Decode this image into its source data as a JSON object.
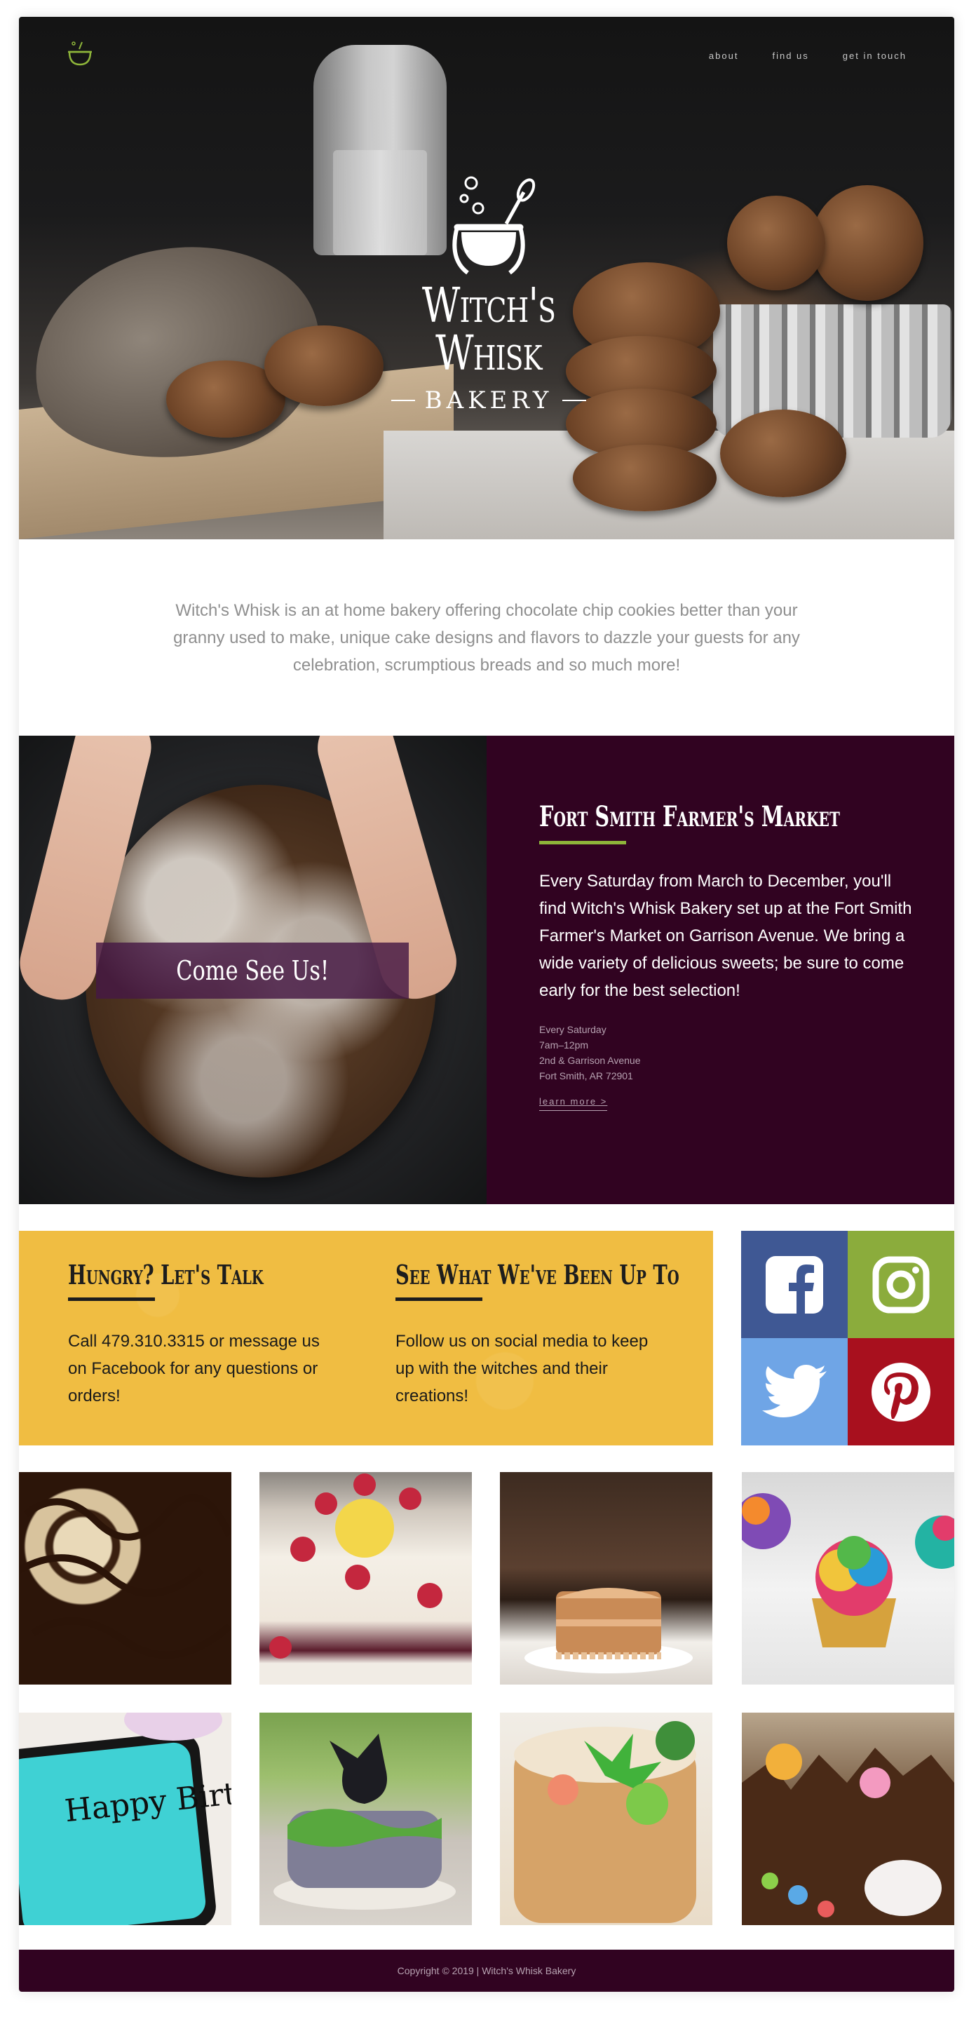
{
  "nav": {
    "items": [
      "about",
      "find us",
      "get in touch"
    ]
  },
  "hero": {
    "brand_name": "Witch's Whisk",
    "brand_sub": "BAKERY"
  },
  "intro": {
    "text": "Witch's Whisk is an at home bakery offering chocolate chip cookies better than your granny used to make, unique cake designs and flavors to dazzle your guests for any celebration, scrumptious breads and so much more!"
  },
  "market": {
    "cta": "Come See Us!",
    "title": "Fort Smith Farmer's Market",
    "description": "Every Saturday from March to December, you'll find Witch's Whisk Bakery set up at the Fort Smith Farmer's Market on Garrison Avenue. We bring a wide variety of delicious sweets; be sure to come early for the best selection!",
    "details": [
      "Every Saturday",
      "7am–12pm",
      "2nd & Garrison Avenue",
      "Fort Smith, AR 72901"
    ],
    "learn_more": "learn more  >"
  },
  "contact": {
    "talk_title": "Hungry? Let's Talk",
    "talk_text": "Call 479.310.3315 or message us on Facebook for any questions or orders!",
    "social_title": "See What We've Been Up To",
    "social_text": "Follow us on social media to keep up with the witches and their creations!"
  },
  "social": [
    {
      "icon": "facebook-icon",
      "color": "#3f5894"
    },
    {
      "icon": "instagram-icon",
      "color": "#8bac3c"
    },
    {
      "icon": "twitter-icon",
      "color": "#6fa5e6"
    },
    {
      "icon": "pinterest-icon",
      "color": "#a8101e"
    }
  ],
  "gallery": [
    "chocolate-drizzle-cookies-photo",
    "lemon-raspberry-cake-photo",
    "caramel-cake-photo",
    "rainbow-cupcakes-photo",
    "happy-birthday-cookie-photo",
    "dragon-cake-photo",
    "succulent-cake-photo",
    "woodland-cake-photo"
  ],
  "birthday_cookie_text": "Happy Birthday",
  "footer": {
    "text": "Copyright © 2019  |  Witch's Whisk Bakery"
  },
  "colors": {
    "plum": "#310321",
    "mustard": "#f0bd42",
    "green": "#8eb53a"
  }
}
